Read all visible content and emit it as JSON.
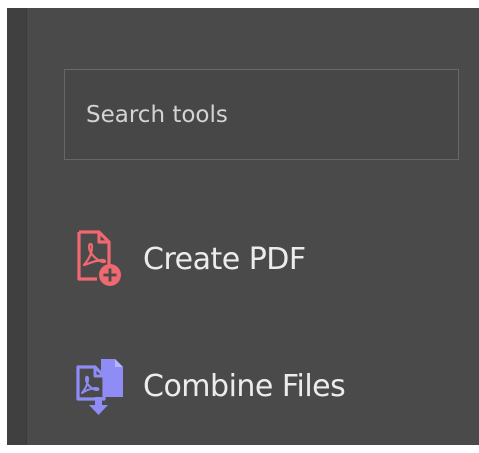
{
  "search": {
    "placeholder": "Search tools"
  },
  "tools": [
    {
      "label": "Create PDF",
      "icon": "create-pdf-icon",
      "color": "#f06870"
    },
    {
      "label": "Combine Files",
      "icon": "combine-files-icon",
      "color": "#8f8cf6"
    }
  ],
  "colors": {
    "panel_bg": "#4a4a4a",
    "search_border": "#676767",
    "text": "#ececec",
    "create_accent": "#f06870",
    "combine_accent": "#8f8cf6"
  }
}
